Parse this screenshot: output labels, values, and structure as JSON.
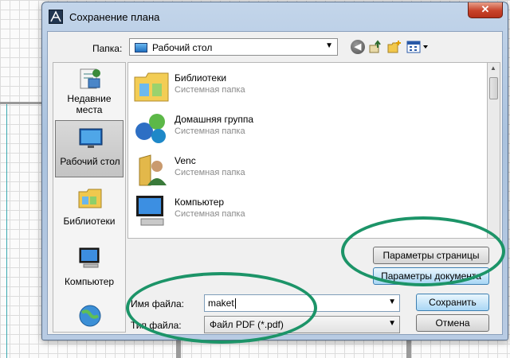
{
  "window": {
    "title": "Сохранение плана",
    "close_glyph": "✕"
  },
  "toolbar": {
    "folder_label": "Папка:",
    "folder_value": "Рабочий стол",
    "icons": [
      "back-icon",
      "up-folder-icon",
      "new-folder-icon",
      "view-menu-icon"
    ]
  },
  "places": [
    {
      "label_line1": "Недавние",
      "label_line2": "места",
      "icon": "recent-places-icon"
    },
    {
      "label": "Рабочий стол",
      "icon": "desktop-icon",
      "selected": true
    },
    {
      "label": "Библиотеки",
      "icon": "libraries-icon"
    },
    {
      "label": "Компьютер",
      "icon": "computer-icon"
    },
    {
      "icon": "network-icon"
    }
  ],
  "files": [
    {
      "name": "Библиотеки",
      "type": "Системная папка",
      "icon": "libraries-icon"
    },
    {
      "name": "Домашняя группа",
      "type": "Системная папка",
      "icon": "homegroup-icon"
    },
    {
      "name": "Venc",
      "type": "Системная папка",
      "icon": "user-folder-icon"
    },
    {
      "name": "Компьютер",
      "type": "Системная папка",
      "icon": "computer-icon"
    }
  ],
  "form": {
    "filename_label": "Имя файла:",
    "filename_value": "maket",
    "filetype_label": "Тип файла:",
    "filetype_value": "Файл PDF (*.pdf)"
  },
  "buttons": {
    "page_settings": "Параметры страницы",
    "doc_settings": "Параметры документа",
    "save": "Сохранить",
    "cancel": "Отмена"
  },
  "colors": {
    "annotation": "#1c9468",
    "accent": "#3c7fb1"
  }
}
